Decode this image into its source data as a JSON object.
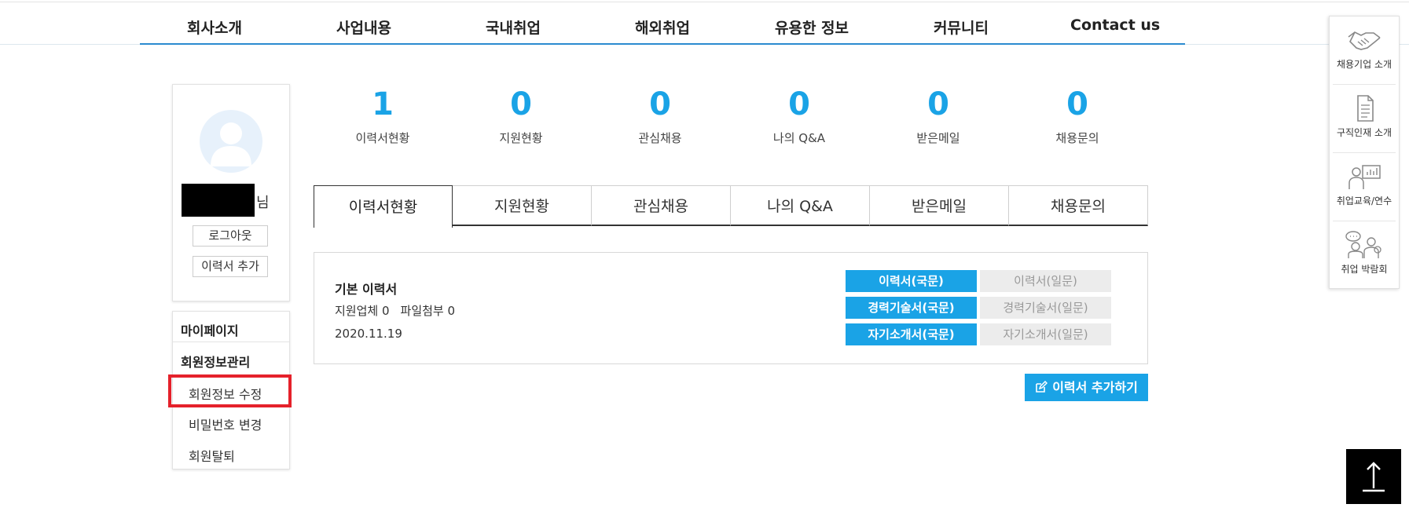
{
  "nav": {
    "items": [
      "회사소개",
      "사업내용",
      "국내취업",
      "해외취업",
      "유용한 정보",
      "커뮤니티",
      "Contact us"
    ]
  },
  "profile": {
    "name_suffix": "님",
    "logout_label": "로그아웃",
    "add_resume_label": "이력서 추가"
  },
  "menu": {
    "mypage": "마이페이지",
    "member_info": "회원정보관리",
    "edit_info": "회원정보 수정",
    "change_password": "비밀번호 변경",
    "withdraw": "회원탈퇴"
  },
  "stats": [
    {
      "value": "1",
      "label": "이력서현황"
    },
    {
      "value": "0",
      "label": "지원현황"
    },
    {
      "value": "0",
      "label": "관심채용"
    },
    {
      "value": "0",
      "label": "나의 Q&A"
    },
    {
      "value": "0",
      "label": "받은메일"
    },
    {
      "value": "0",
      "label": "채용문의"
    }
  ],
  "tabs": [
    "이력서현황",
    "지원현황",
    "관심채용",
    "나의 Q&A",
    "받은메일",
    "채용문의"
  ],
  "active_tab": "이력서현황",
  "resume": {
    "title": "기본 이력서",
    "applied_label": "지원업체 0",
    "attach_label": "파일첨부 0",
    "date": "2020.11.19",
    "buttons": {
      "resume_kr": "이력서(국문)",
      "resume_jp": "이력서(일문)",
      "career_kr": "경력기술서(국문)",
      "career_jp": "경력기술서(일문)",
      "intro_kr": "자기소개서(국문)",
      "intro_jp": "자기소개서(일문)"
    }
  },
  "add_resume_button": "이력서 추가하기",
  "quick_menu": [
    {
      "label": "채용기업 소개",
      "icon": "handshake-icon"
    },
    {
      "label": "구직인재 소개",
      "icon": "document-icon"
    },
    {
      "label": "취업교육/연수",
      "icon": "presentation-icon"
    },
    {
      "label": "취업 박람회",
      "icon": "people-chat-icon"
    }
  ],
  "colors": {
    "accent": "#1aa3e6",
    "highlight": "#e5212b",
    "nav_line": "#2b8bd0"
  }
}
